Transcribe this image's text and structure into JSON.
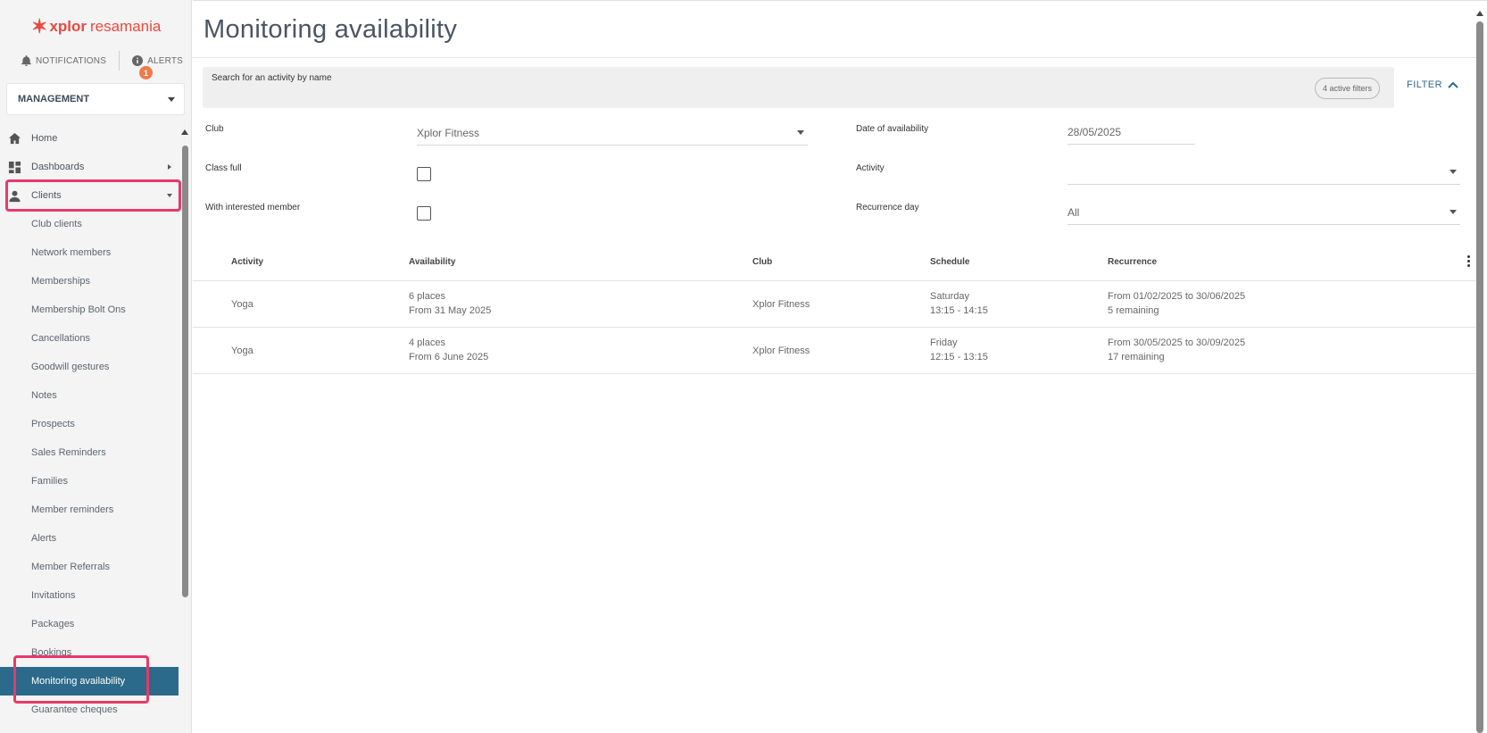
{
  "sidebar": {
    "logo_brand": "xplor",
    "logo_product": "resamania",
    "notifications_label": "NOTIFICATIONS",
    "alerts_label": "ALERTS",
    "alerts_count": "1",
    "management_label": "MANAGEMENT",
    "nav": {
      "home": "Home",
      "dashboards": "Dashboards",
      "clients": "Clients"
    },
    "sub_items": [
      "Club clients",
      "Network members",
      "Memberships",
      "Membership Bolt Ons",
      "Cancellations",
      "Goodwill gestures",
      "Notes",
      "Prospects",
      "Sales Reminders",
      "Families",
      "Member reminders",
      "Alerts",
      "Member Referrals",
      "Invitations",
      "Packages",
      "Bookings",
      "Monitoring availability",
      "Guarantee cheques"
    ]
  },
  "main": {
    "title": "Monitoring availability",
    "search_placeholder": "Search for an activity by name",
    "active_filters": "4 active filters",
    "filter_button": "FILTER",
    "filters": {
      "club_label": "Club",
      "club_value": "Xplor Fitness",
      "date_label": "Date of availability",
      "date_value": "28/05/2025",
      "class_full_label": "Class full",
      "activity_label": "Activity",
      "activity_value": "",
      "interested_label": "With interested member",
      "recurrence_label": "Recurrence day",
      "recurrence_value": "All"
    },
    "table": {
      "headers": [
        "Activity",
        "Availability",
        "Club",
        "Schedule",
        "Recurrence"
      ],
      "rows": [
        {
          "activity": "Yoga",
          "availability_places": "6 places",
          "availability_from": "From 31 May 2025",
          "club": "Xplor Fitness",
          "schedule_day": "Saturday",
          "schedule_time": "13:15 - 14:15",
          "recurrence_range": "From 01/02/2025 to 30/06/2025",
          "recurrence_remaining": "5 remaining"
        },
        {
          "activity": "Yoga",
          "availability_places": "4 places",
          "availability_from": "From 6 June 2025",
          "club": "Xplor Fitness",
          "schedule_day": "Friday",
          "schedule_time": "12:15 - 13:15",
          "recurrence_range": "From 30/05/2025 to 30/09/2025",
          "recurrence_remaining": "17 remaining"
        }
      ]
    }
  },
  "colors": {
    "brand": "#e8493f",
    "accent": "#2b6a8a",
    "highlight": "#e8396a",
    "badge": "#f07a4a"
  }
}
